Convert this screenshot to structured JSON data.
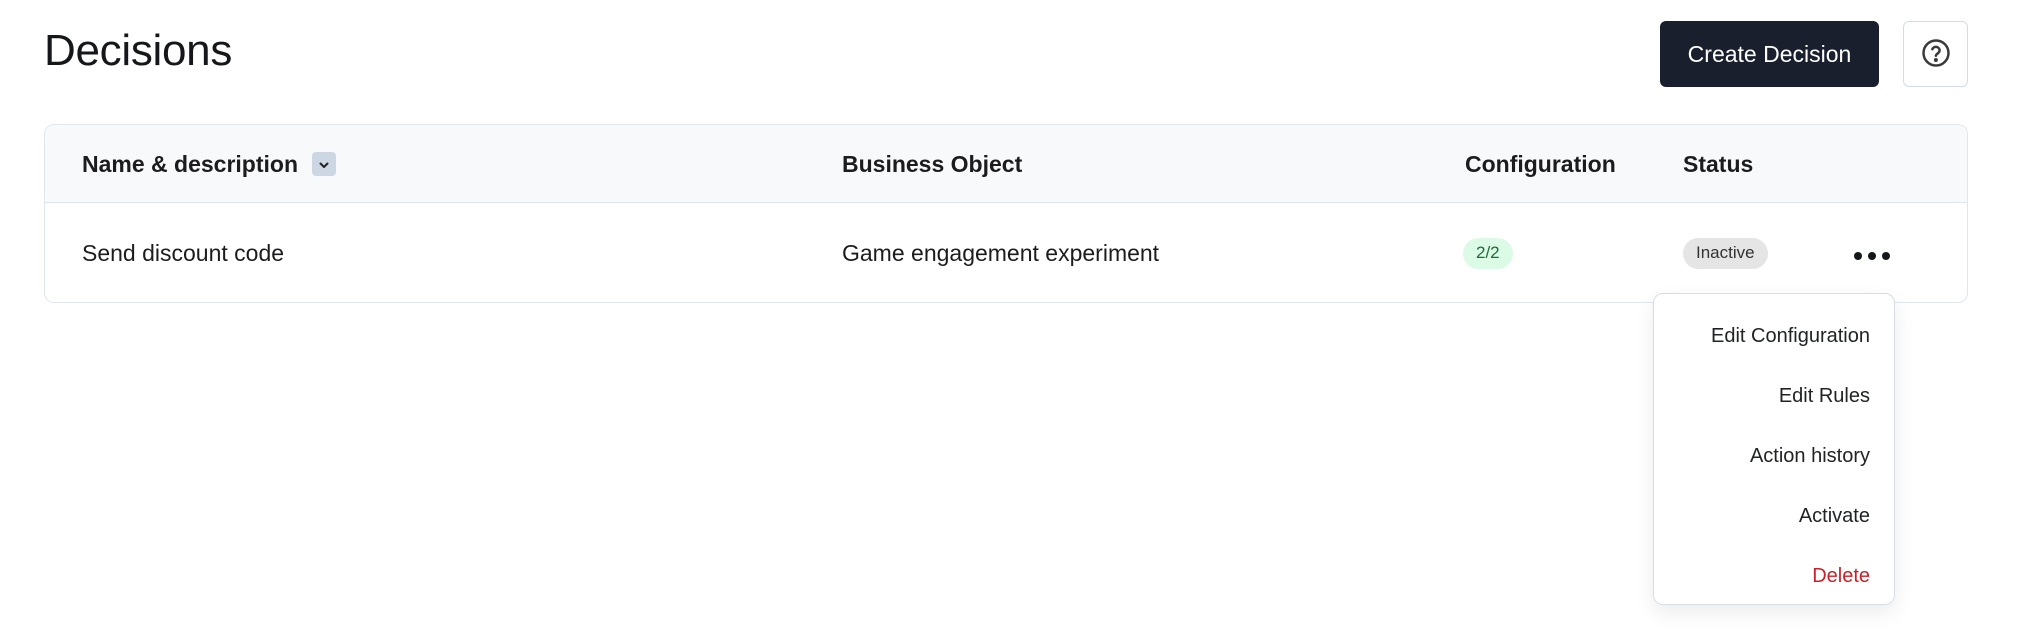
{
  "page": {
    "title": "Decisions"
  },
  "header": {
    "create_label": "Create Decision",
    "help_icon": "help-circle-icon"
  },
  "colors": {
    "primary_button": "#1a1f2e",
    "config_badge_bg": "#dcfbe6",
    "config_badge_text": "#1e6b3a",
    "status_badge_bg": "#e5e5e5",
    "danger": "#c5222b"
  },
  "table": {
    "columns": [
      {
        "label": "Name & description",
        "sortable": true,
        "sort_icon": "chevron-down-icon"
      },
      {
        "label": "Business Object"
      },
      {
        "label": "Configuration"
      },
      {
        "label": "Status"
      }
    ],
    "rows": [
      {
        "name": "Send discount code",
        "business_object": "Game engagement experiment",
        "configuration": "2/2",
        "status": "Inactive",
        "actions_icon": "more-horizontal-icon"
      }
    ]
  },
  "row_menu": {
    "items": [
      {
        "label": "Edit Configuration"
      },
      {
        "label": "Edit Rules"
      },
      {
        "label": "Action history"
      },
      {
        "label": "Activate"
      },
      {
        "label": "Delete",
        "variant": "danger"
      }
    ]
  }
}
